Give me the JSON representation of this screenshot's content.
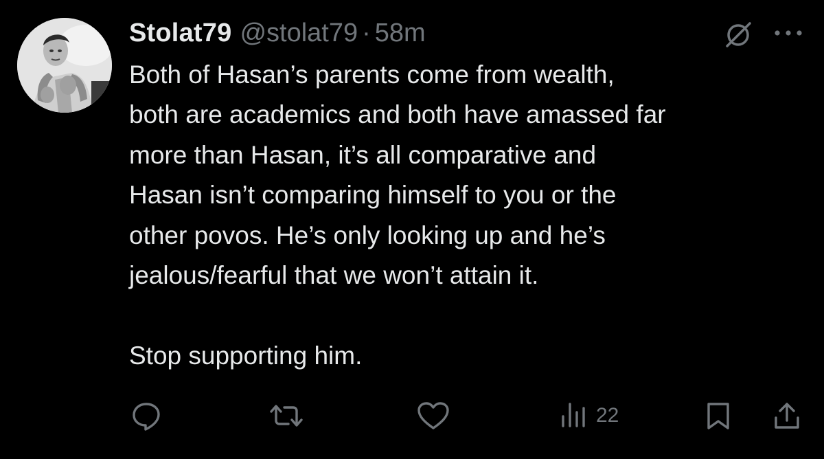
{
  "tweet": {
    "display_name": "Stolat79",
    "handle": "@stolat79",
    "separator": "·",
    "time": "58m",
    "lines": [
      "Both of Hasan’s parents come from wealth,",
      "both are academics and both have amassed far",
      "more than Hasan, it’s all comparative and",
      "Hasan isn’t comparing himself to you or the",
      "other povos.  He’s only looking up and he’s",
      "jealous/fearful that we won’t attain it."
    ],
    "closing_line": "Stop supporting him.",
    "views": "22"
  },
  "icons": {
    "header": [
      "grok-icon",
      "more-icon"
    ],
    "actions": [
      "reply-icon",
      "retweet-icon",
      "like-icon",
      "views-icon",
      "bookmark-icon",
      "share-icon"
    ]
  },
  "colors": {
    "background": "#000000",
    "text_primary": "#e7e9ea",
    "text_secondary": "#71767b"
  }
}
